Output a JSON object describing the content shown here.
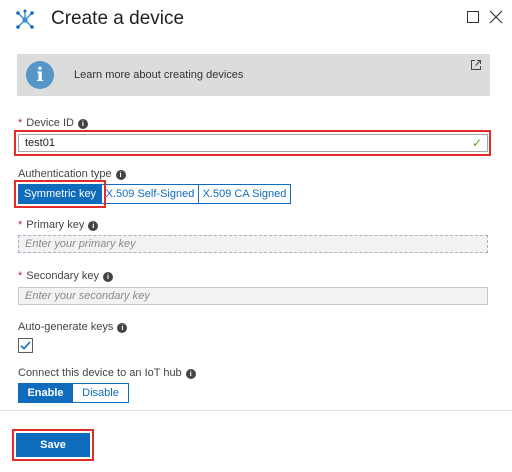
{
  "header": {
    "title": "Create a device",
    "icon": "iot-device-icon"
  },
  "banner": {
    "text": "Learn more about creating devices"
  },
  "device_id": {
    "label": "Device ID",
    "value": "test01"
  },
  "auth": {
    "label": "Authentication type",
    "options": [
      "Symmetric key",
      "X.509 Self-Signed",
      "X.509 CA Signed"
    ],
    "selected": "Symmetric key"
  },
  "primary_key": {
    "label": "Primary key",
    "placeholder": "Enter your primary key"
  },
  "secondary_key": {
    "label": "Secondary key",
    "placeholder": "Enter your secondary key"
  },
  "auto_generate": {
    "label": "Auto-generate keys",
    "checked": true
  },
  "connect": {
    "label": "Connect this device to an IoT hub",
    "options": [
      "Enable",
      "Disable"
    ],
    "selected": "Enable"
  },
  "footer": {
    "save_label": "Save"
  },
  "colors": {
    "accent": "#0f6cbd",
    "highlight": "#e52a2a",
    "success": "#5ba41e",
    "info": "#5596c8"
  }
}
